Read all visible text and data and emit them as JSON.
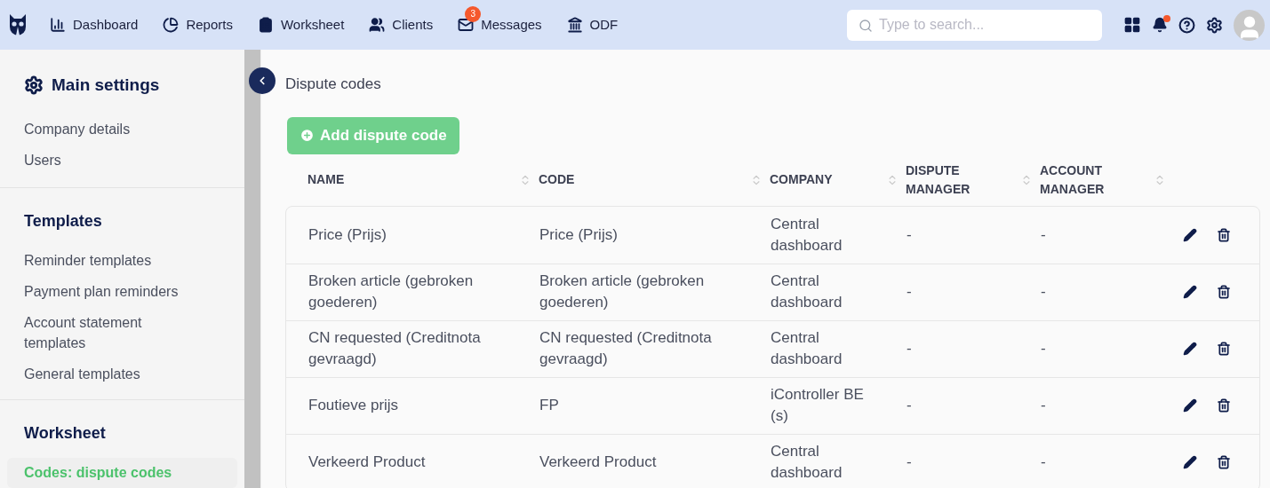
{
  "nav": [
    {
      "label": "Dashboard"
    },
    {
      "label": "Reports"
    },
    {
      "label": "Worksheet"
    },
    {
      "label": "Clients"
    },
    {
      "label": "Messages",
      "badge": "3"
    },
    {
      "label": "ODF"
    }
  ],
  "search": {
    "placeholder": "Type to search..."
  },
  "notifications": {
    "unread": true
  },
  "sidebar": {
    "title": "Main settings",
    "sections": [
      {
        "items": [
          {
            "label": "Company details",
            "selected": false
          },
          {
            "label": "Users",
            "selected": false
          }
        ]
      },
      {
        "heading": "Templates",
        "items": [
          {
            "label": "Reminder templates",
            "selected": false
          },
          {
            "label": "Payment plan reminders",
            "selected": false
          },
          {
            "label": "Account statement templates",
            "selected": false
          },
          {
            "label": "General templates",
            "selected": false
          }
        ]
      },
      {
        "heading": "Worksheet",
        "items": [
          {
            "label": "Codes: dispute codes",
            "selected": true
          }
        ]
      }
    ]
  },
  "page": {
    "title": "Dispute codes",
    "add_button": "Add dispute code"
  },
  "table": {
    "columns": [
      {
        "label": "NAME"
      },
      {
        "label": "CODE"
      },
      {
        "label": "COMPANY"
      },
      {
        "label": "DISPUTE MANAGER"
      },
      {
        "label": "ACCOUNT MANAGER"
      }
    ],
    "rows": [
      [
        "Price (Prijs)",
        "Price (Prijs)",
        "Central dashboard",
        "-",
        "-"
      ],
      [
        "Broken article (gebroken goederen)",
        "Broken article (gebroken goederen)",
        "Central dashboard",
        "-",
        "-"
      ],
      [
        "CN requested (Creditnota gevraagd)",
        "CN requested (Creditnota gevraagd)",
        "Central dashboard",
        "-",
        "-"
      ],
      [
        "Foutieve prijs",
        "FP",
        "iController BE (s)",
        "-",
        "-"
      ],
      [
        "Verkeerd Product",
        "Verkeerd Product",
        "Central dashboard",
        "-",
        "-"
      ]
    ]
  }
}
